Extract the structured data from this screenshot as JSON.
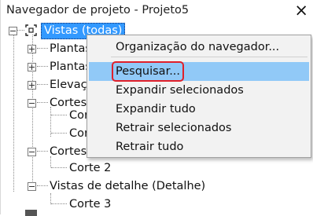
{
  "panel": {
    "title": "Navegador de projeto - Projeto5",
    "close_icon": "×"
  },
  "tree": {
    "root": "Vistas (todas)",
    "items": [
      {
        "label": "Plantas"
      },
      {
        "label": "Plantas"
      },
      {
        "label": "Elevaçõ"
      },
      {
        "label": "Cortes"
      },
      {
        "label": "Corte"
      },
      {
        "label": "Cor"
      },
      {
        "label": "Cortes"
      },
      {
        "label": "Corte 2"
      },
      {
        "label": "Vistas de detalhe (Detalhe)"
      },
      {
        "label": "Corte 3"
      }
    ]
  },
  "context_menu": {
    "items": [
      {
        "label": "Organização do navegador..."
      },
      {
        "label": "Pesquisar..."
      },
      {
        "label": "Expandir selecionados"
      },
      {
        "label": "Expandir tudo"
      },
      {
        "label": "Retrair selecionados"
      },
      {
        "label": "Retrair tudo"
      }
    ],
    "highlight_color": "#91c9f7",
    "focus_outline_color": "#e0202a"
  },
  "colors": {
    "selection": "#3399ff",
    "menu_background": "#f2f2f2"
  }
}
